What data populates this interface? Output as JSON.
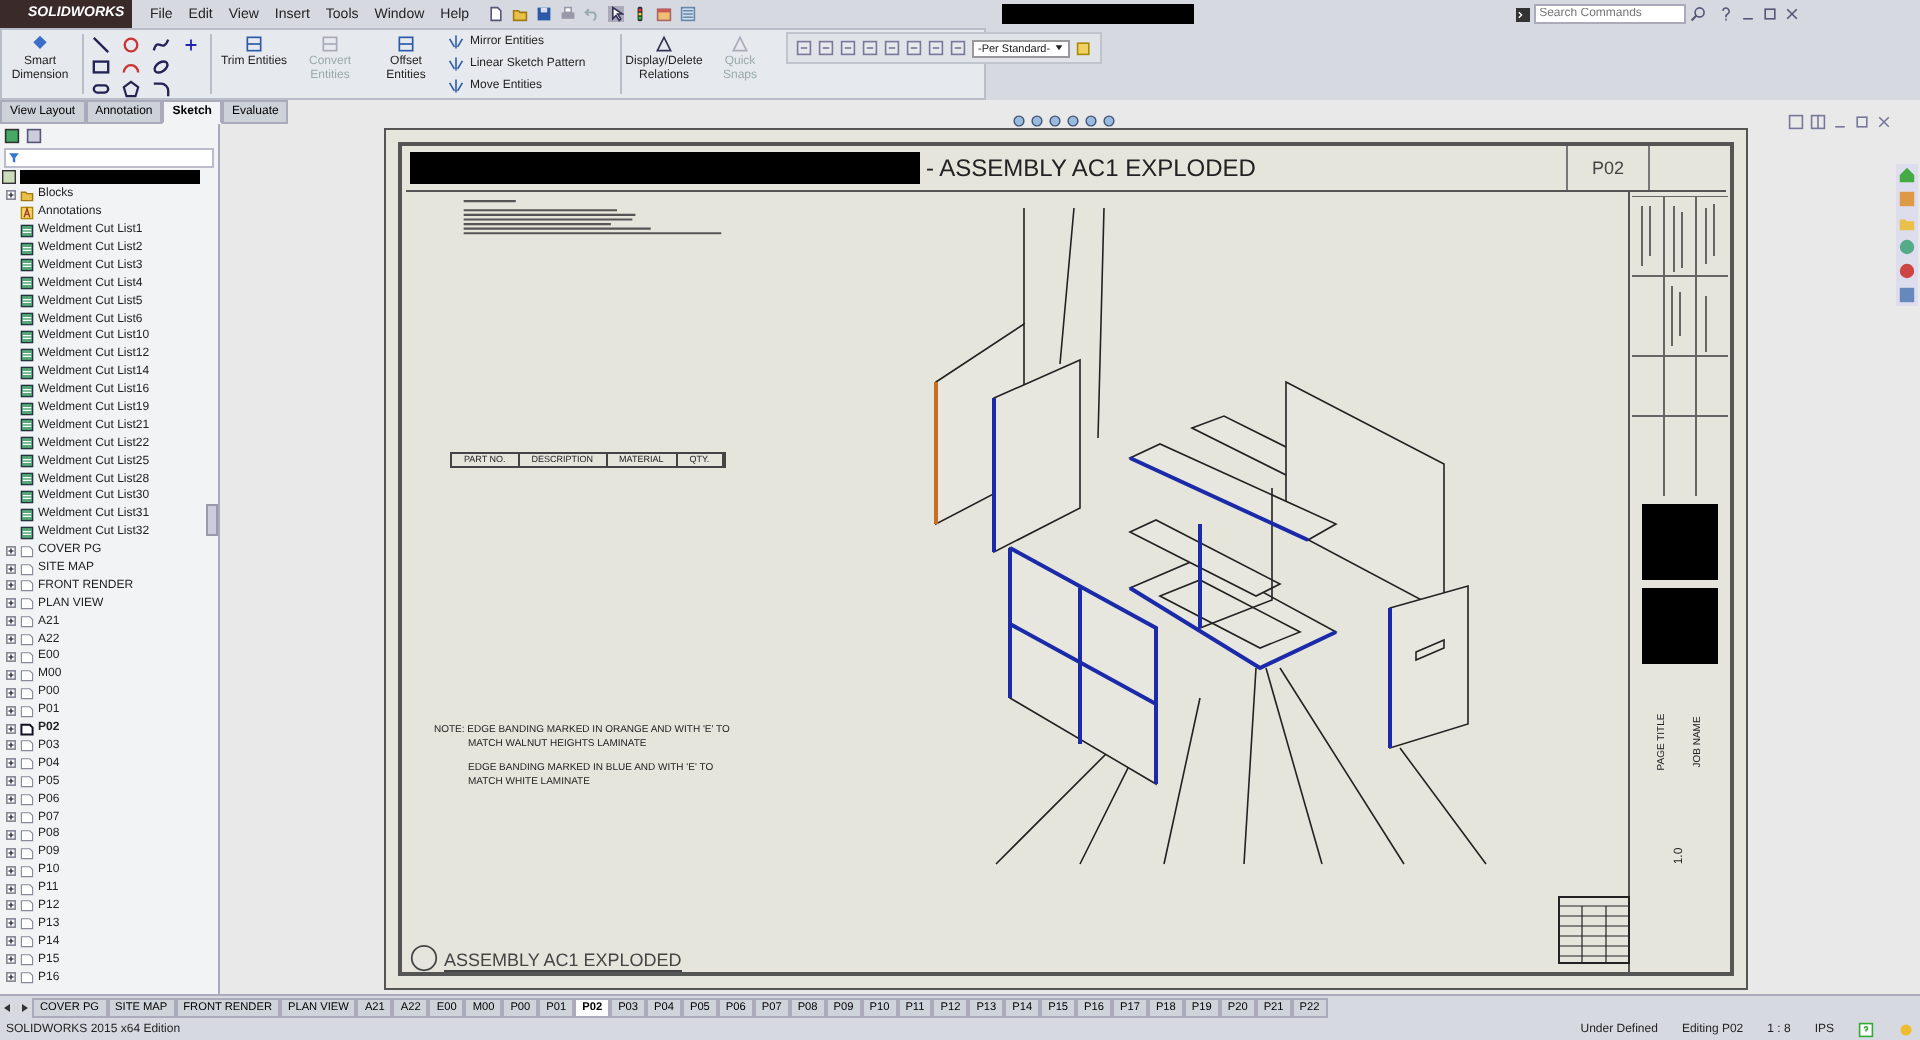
{
  "app": {
    "logo": "SOLIDWORKS",
    "menu": [
      "File",
      "Edit",
      "View",
      "Insert",
      "Tools",
      "Window",
      "Help"
    ],
    "search": {
      "placeholder": "Search Commands"
    }
  },
  "ribbon": {
    "tools": [
      {
        "label": "Smart Dimension",
        "kind": "big",
        "disabled": false
      },
      {
        "label": "Trim Entities",
        "kind": "big",
        "disabled": false
      },
      {
        "label": "Convert Entities",
        "kind": "big",
        "disabled": true
      },
      {
        "label": "Offset Entities",
        "kind": "big",
        "disabled": false
      },
      {
        "label": "Mirror Entities",
        "kind": "small",
        "disabled": false
      },
      {
        "label": "Linear Sketch Pattern",
        "kind": "small",
        "disabled": false
      },
      {
        "label": "Move Entities",
        "kind": "small",
        "disabled": false
      },
      {
        "label": "Display/Delete Relations",
        "kind": "big",
        "disabled": false
      },
      {
        "label": "Quick Snaps",
        "kind": "big",
        "disabled": true
      }
    ],
    "standard_dropdown": "-Per Standard-",
    "tabs": [
      {
        "label": "View Layout",
        "selected": false
      },
      {
        "label": "Annotation",
        "selected": false
      },
      {
        "label": "Sketch",
        "selected": true
      },
      {
        "label": "Evaluate",
        "selected": false
      }
    ]
  },
  "tree": {
    "children": [
      {
        "label": "Blocks",
        "kind": "folder",
        "selected": false
      },
      {
        "label": "Annotations",
        "kind": "annotations",
        "selected": false
      },
      {
        "label": "Weldment Cut List1",
        "kind": "cut-list",
        "selected": false
      },
      {
        "label": "Weldment Cut List2",
        "kind": "cut-list",
        "selected": false
      },
      {
        "label": "Weldment Cut List3",
        "kind": "cut-list",
        "selected": false
      },
      {
        "label": "Weldment Cut List4",
        "kind": "cut-list",
        "selected": false
      },
      {
        "label": "Weldment Cut List5",
        "kind": "cut-list",
        "selected": false
      },
      {
        "label": "Weldment Cut List6",
        "kind": "cut-list",
        "selected": false
      },
      {
        "label": "Weldment Cut List10",
        "kind": "cut-list",
        "selected": false
      },
      {
        "label": "Weldment Cut List12",
        "kind": "cut-list",
        "selected": false
      },
      {
        "label": "Weldment Cut List14",
        "kind": "cut-list",
        "selected": false
      },
      {
        "label": "Weldment Cut List16",
        "kind": "cut-list",
        "selected": false
      },
      {
        "label": "Weldment Cut List19",
        "kind": "cut-list",
        "selected": false
      },
      {
        "label": "Weldment Cut List21",
        "kind": "cut-list",
        "selected": false
      },
      {
        "label": "Weldment Cut List22",
        "kind": "cut-list",
        "selected": false
      },
      {
        "label": "Weldment Cut List25",
        "kind": "cut-list",
        "selected": false
      },
      {
        "label": "Weldment Cut List28",
        "kind": "cut-list",
        "selected": false
      },
      {
        "label": "Weldment Cut List30",
        "kind": "cut-list",
        "selected": false
      },
      {
        "label": "Weldment Cut List31",
        "kind": "cut-list",
        "selected": false
      },
      {
        "label": "Weldment Cut List32",
        "kind": "cut-list",
        "selected": false
      },
      {
        "label": "COVER PG",
        "kind": "sheet",
        "selected": false
      },
      {
        "label": "SITE MAP",
        "kind": "sheet",
        "selected": false
      },
      {
        "label": "FRONT RENDER",
        "kind": "sheet",
        "selected": false
      },
      {
        "label": "PLAN VIEW",
        "kind": "sheet",
        "selected": false
      },
      {
        "label": "A21",
        "kind": "sheet",
        "selected": false
      },
      {
        "label": "A22",
        "kind": "sheet",
        "selected": false
      },
      {
        "label": "E00",
        "kind": "sheet",
        "selected": false
      },
      {
        "label": "M00",
        "kind": "sheet",
        "selected": false
      },
      {
        "label": "P00",
        "kind": "sheet",
        "selected": false
      },
      {
        "label": "P01",
        "kind": "sheet",
        "selected": false
      },
      {
        "label": "P02",
        "kind": "sheet",
        "selected": true
      },
      {
        "label": "P03",
        "kind": "sheet",
        "selected": false
      },
      {
        "label": "P04",
        "kind": "sheet",
        "selected": false
      },
      {
        "label": "P05",
        "kind": "sheet",
        "selected": false
      },
      {
        "label": "P06",
        "kind": "sheet",
        "selected": false
      },
      {
        "label": "P07",
        "kind": "sheet",
        "selected": false
      },
      {
        "label": "P08",
        "kind": "sheet",
        "selected": false
      },
      {
        "label": "P09",
        "kind": "sheet",
        "selected": false
      },
      {
        "label": "P10",
        "kind": "sheet",
        "selected": false
      },
      {
        "label": "P11",
        "kind": "sheet",
        "selected": false
      },
      {
        "label": "P12",
        "kind": "sheet",
        "selected": false
      },
      {
        "label": "P13",
        "kind": "sheet",
        "selected": false
      },
      {
        "label": "P14",
        "kind": "sheet",
        "selected": false
      },
      {
        "label": "P15",
        "kind": "sheet",
        "selected": false
      },
      {
        "label": "P16",
        "kind": "sheet",
        "selected": false
      }
    ]
  },
  "sheet": {
    "title": "- ASSEMBLY AC1 EXPLODED",
    "page": "P02",
    "bom_columns": [
      "PART NO.",
      "DESCRIPTION",
      "MATERIAL",
      "QTY."
    ],
    "notes": [
      "NOTE: EDGE BANDING MARKED IN ORANGE AND WITH 'E' TO",
      "MATCH WALNUT HEIGHTS LAMINATE",
      "EDGE BANDING MARKED IN BLUE AND WITH 'E' TO",
      "MATCH WHITE LAMINATE"
    ],
    "view_label": "ASSEMBLY AC1 EXPLODED",
    "title_block": {
      "page_title_label": "PAGE TITLE",
      "job_name_label": "JOB NAME",
      "revision": "1.0"
    }
  },
  "sheet_tabs": [
    {
      "label": "COVER PG",
      "selected": false
    },
    {
      "label": "SITE MAP",
      "selected": false
    },
    {
      "label": "FRONT RENDER",
      "selected": false
    },
    {
      "label": "PLAN VIEW",
      "selected": false
    },
    {
      "label": "A21",
      "selected": false
    },
    {
      "label": "A22",
      "selected": false
    },
    {
      "label": "E00",
      "selected": false
    },
    {
      "label": "M00",
      "selected": false
    },
    {
      "label": "P00",
      "selected": false
    },
    {
      "label": "P01",
      "selected": false
    },
    {
      "label": "P02",
      "selected": true
    },
    {
      "label": "P03",
      "selected": false
    },
    {
      "label": "P04",
      "selected": false
    },
    {
      "label": "P05",
      "selected": false
    },
    {
      "label": "P06",
      "selected": false
    },
    {
      "label": "P07",
      "selected": false
    },
    {
      "label": "P08",
      "selected": false
    },
    {
      "label": "P09",
      "selected": false
    },
    {
      "label": "P10",
      "selected": false
    },
    {
      "label": "P11",
      "selected": false
    },
    {
      "label": "P12",
      "selected": false
    },
    {
      "label": "P13",
      "selected": false
    },
    {
      "label": "P14",
      "selected": false
    },
    {
      "label": "P15",
      "selected": false
    },
    {
      "label": "P16",
      "selected": false
    },
    {
      "label": "P17",
      "selected": false
    },
    {
      "label": "P18",
      "selected": false
    },
    {
      "label": "P19",
      "selected": false
    },
    {
      "label": "P20",
      "selected": false
    },
    {
      "label": "P21",
      "selected": false
    },
    {
      "label": "P22",
      "selected": false
    }
  ],
  "status_bar": {
    "edition": "SOLIDWORKS 2015 x64 Edition",
    "items": [
      "Under Defined",
      "Editing P02",
      "1 : 8",
      "IPS"
    ]
  }
}
